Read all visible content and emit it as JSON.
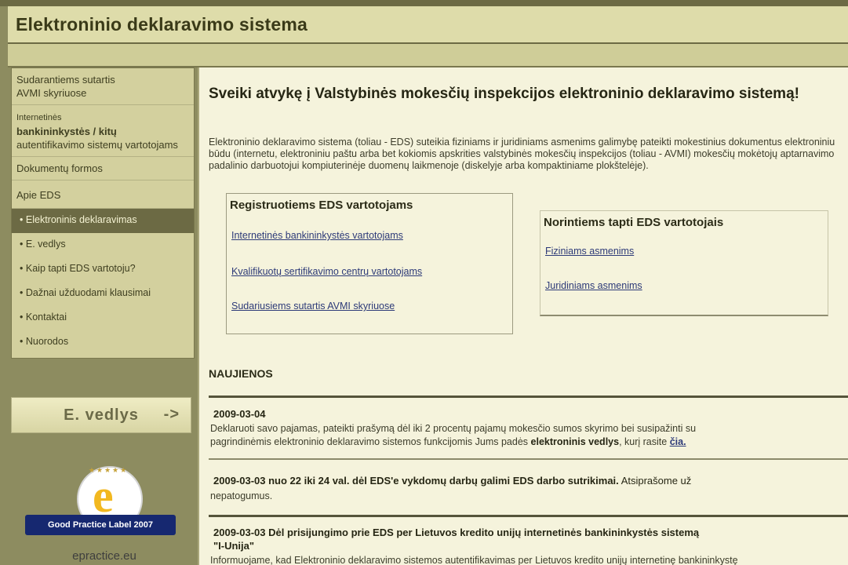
{
  "app": {
    "title": "Elektroninio deklaravimo sistema"
  },
  "sidebar": {
    "items": [
      {
        "lines": [
          "Sudarantiems sutartis",
          "AVMI skyriuose"
        ]
      },
      {
        "small": "Internetinės",
        "bold": "bankininkystės / kitų",
        "rest": "autentifikavimo sistemų vartotojams"
      },
      {
        "label": "Dokumentų formos"
      },
      {
        "label": "Apie EDS"
      }
    ],
    "subitems": [
      {
        "label": "Elektroninis deklaravimas",
        "active": true
      },
      {
        "label": "E. vedlys",
        "active": false
      },
      {
        "label": "Kaip tapti EDS vartotoju?",
        "active": false
      },
      {
        "label": "Dažnai užduodami klausimai",
        "active": false
      },
      {
        "label": "Kontaktai",
        "active": false
      },
      {
        "label": "Nuorodos",
        "active": false
      }
    ],
    "bullet": "•",
    "evedlys": {
      "label": "E. vedlys",
      "arrow": "->"
    },
    "award": {
      "ribbon": "Good Practice Label 2007",
      "brand": "epractice.eu"
    }
  },
  "main": {
    "title": "Sveiki atvykę į Valstybinės mokesčių inspekcijos elektroninio deklaravimo sistemą!",
    "intro": "Elektroninio deklaravimo sistema (toliau - EDS) suteikia fiziniams ir juridiniams asmenims galimybę pateikti mokestinius dokumentus elektroniniu būdu (internetu, elektroniniu paštu arba bet kokiomis apskrities valstybinės mokesčių inspekcijos (toliau - AVMI) mokesčių mokėtojų aptarnavimo padalinio darbuotojui kompiuterinėje duomenų laikmenoje (diskelyje arba kompaktiniame plokštelėje).",
    "registered": {
      "heading": "Registruotiems EDS vartotojams",
      "links": [
        "Internetinės bankininkystės vartotojams",
        "Kvalifikuotų sertifikavimo centrų vartotojams",
        "Sudariusiems sutartis AVMI skyriuose"
      ]
    },
    "wanting": {
      "heading": "Norintiems tapti EDS vartotojais",
      "links": [
        "Fiziniams asmenims",
        "Juridiniams asmenims"
      ]
    },
    "news": {
      "heading": "NAUJIENOS",
      "items": [
        {
          "date": "2009-03-04",
          "text1": "Deklaruoti savo pajamas, pateikti prašymą dėl iki 2 procentų pajamų mokesčio sumos skyrimo bei susipažinti su",
          "text2_pre": "pagrindinėmis elektroninio deklaravimo sistemos funkcijomis Jums padės ",
          "text2_bold": "elektroninis vedlys",
          "text2_mid": ", kurį rasite ",
          "text2_link": "čia."
        },
        {
          "title": "2009-03-03 nuo 22 iki 24 val. dėl EDS'e vykdomų darbų galimi EDS darbo sutrikimai.",
          "rest1": " Atsiprašome už",
          "rest2": "nepatogumus."
        },
        {
          "title": "2009-03-03 Dėl prisijungimo prie EDS per Lietuvos kredito unijų internetinės bankininkystės sistemą",
          "title2": "\"I-Unija\"",
          "text": "Informuojame, kad Elektroninio deklaravimo sistemos autentifikavimas per Lietuvos kredito unijų internetinę bankininkystę"
        }
      ]
    }
  }
}
